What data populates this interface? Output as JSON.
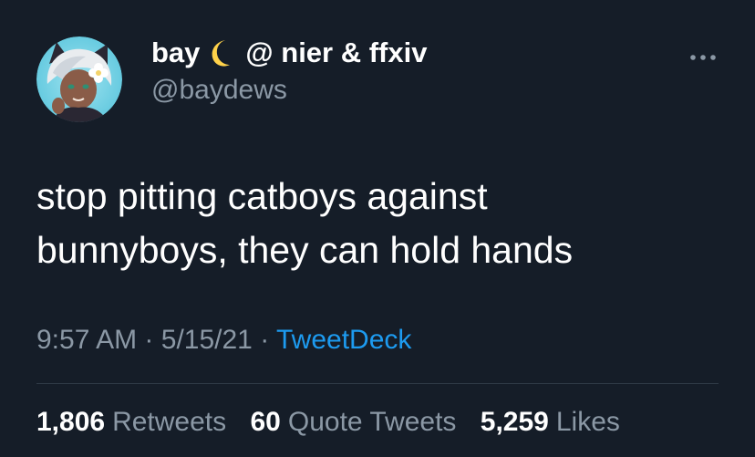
{
  "user": {
    "display_name": "bay",
    "name_suffix": "@ nier & ffxiv",
    "handle": "@baydews",
    "avatar_icon": "avatar-anime-catboy",
    "moon_emoji_icon": "crescent-moon-icon"
  },
  "tweet": {
    "line1": "stop pitting catboys against",
    "line2": "bunnyboys, they can hold hands",
    "time": "9:57 AM",
    "date": "5/15/21",
    "separator": "·",
    "source": "TweetDeck"
  },
  "stats": {
    "retweets_count": "1,806",
    "retweets_label": "Retweets",
    "quotes_count": "60",
    "quotes_label": "Quote Tweets",
    "likes_count": "5,259",
    "likes_label": "Likes"
  },
  "colors": {
    "background": "#151d28",
    "text_primary": "#ffffff",
    "text_secondary": "#8b98a5",
    "link": "#1d9bf0",
    "moon": "#ffd24a"
  }
}
